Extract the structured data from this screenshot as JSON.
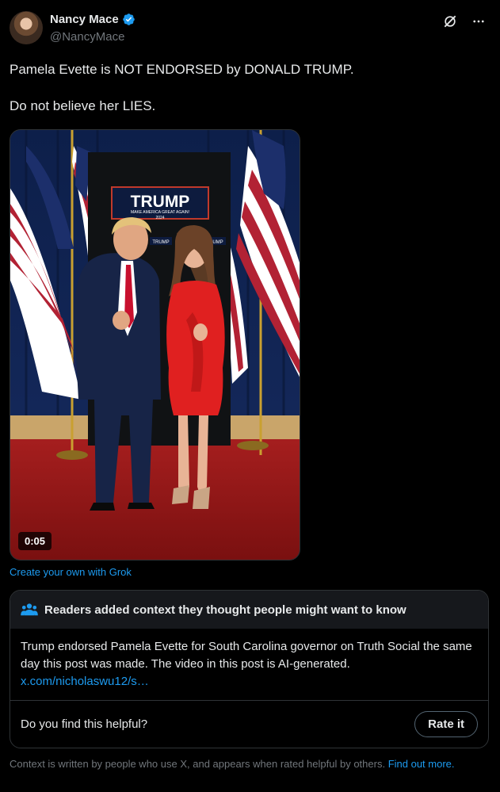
{
  "author": {
    "name": "Nancy Mace",
    "handle": "@NancyMace",
    "verified": true
  },
  "icons": {
    "verified": "verified-badge-icon",
    "grok": "grok-icon",
    "more": "more-options-icon",
    "readers": "readers-icon"
  },
  "post": {
    "line1": "Pamela Evette is NOT ENDORSED by DONALD TRUMP.",
    "line2": "Do not believe her LIES."
  },
  "media": {
    "duration": "0:05",
    "banner_text": "TRUMP",
    "banner_sub": "MAKE AMERICA GREAT AGAIN!",
    "banner_year": "2024",
    "mini_banner": "TRUMP"
  },
  "grok_link": "Create your own with Grok",
  "community_note": {
    "title": "Readers added context they thought people might want to know",
    "body": "Trump endorsed Pamela Evette for South Carolina governor on Truth Social the same day this post was made. The video in this post is AI-generated.",
    "link": "x.com/nicholaswu12/s…",
    "helpful_question": "Do you find this helpful?",
    "rate_button": "Rate it"
  },
  "footer": {
    "text": "Context is written by people who use X, and appears when rated helpful by others.",
    "link": "Find out more."
  },
  "colors": {
    "accent": "#1d9bf0",
    "secondary_text": "#71767b",
    "border": "#2f3336"
  }
}
